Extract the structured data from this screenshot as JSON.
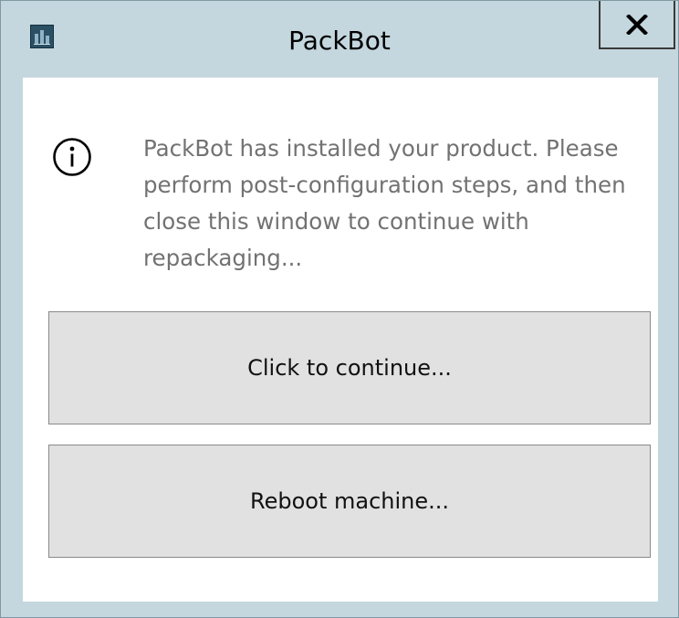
{
  "window": {
    "title": "PackBot",
    "app_icon": "packbot-app-icon",
    "close_label": "X"
  },
  "dialog": {
    "icon": "info-icon",
    "message": "PackBot has installed your product. Please perform post-configuration steps, and then close this window to continue with repackaging...",
    "buttons": {
      "continue_label": "Click to continue...",
      "reboot_label": "Reboot machine..."
    }
  },
  "colors": {
    "frame": "#c4d7de",
    "message_text": "#727272",
    "button_face": "#e1e1e1"
  }
}
